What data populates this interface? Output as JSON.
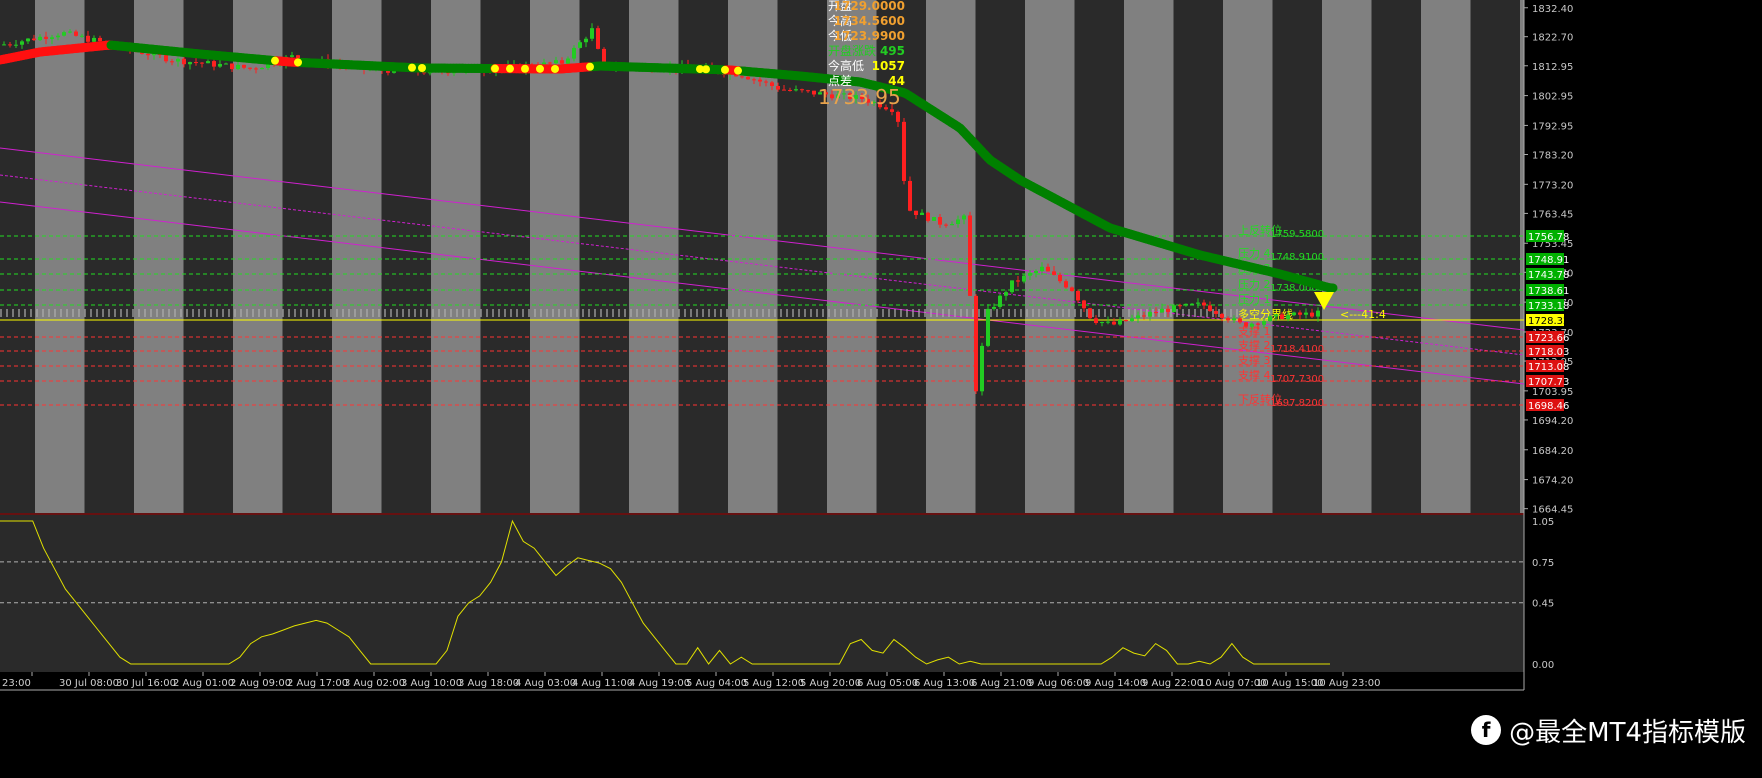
{
  "chart_data": {
    "type": "candlestick",
    "price_axis": {
      "ticks": [
        "1832.40",
        "1822.70",
        "1812.95",
        "1802.95",
        "1792.95",
        "1783.20",
        "1773.20",
        "1763.45",
        "1753.45",
        "1743.70",
        "1733.70",
        "1723.70",
        "1713.95",
        "1703.95",
        "1694.20",
        "1684.20",
        "1674.20",
        "1664.45"
      ]
    },
    "time_axis": {
      "ticks": [
        "23:00",
        "30 Jul 08:00",
        "30 Jul 16:00",
        "2 Aug 01:00",
        "2 Aug 09:00",
        "2 Aug 17:00",
        "3 Aug 02:00",
        "3 Aug 10:00",
        "3 Aug 18:00",
        "4 Aug 03:00",
        "4 Aug 11:00",
        "4 Aug 19:00",
        "5 Aug 04:00",
        "5 Aug 12:00",
        "5 Aug 20:00",
        "6 Aug 05:00",
        "6 Aug 13:00",
        "6 Aug 21:00",
        "9 Aug 06:00",
        "9 Aug 14:00",
        "9 Aug 22:00",
        "10 Aug 07:00",
        "10 Aug 15:00",
        "10 Aug 23:00"
      ]
    },
    "info_panel": [
      {
        "label": "开盘",
        "value": "1729.0000",
        "label_color": "#ffffff",
        "value_color": "#f0a030"
      },
      {
        "label": "今高",
        "value": "1734.5600",
        "label_color": "#ffffff",
        "value_color": "#f0a030"
      },
      {
        "label": "今低",
        "value": "1723.9900",
        "label_color": "#ffffff",
        "value_color": "#f0a030"
      },
      {
        "label": "开盘涨跌",
        "value": "495",
        "label_color": "#22cc22",
        "value_color": "#22cc22"
      },
      {
        "label": "今高低",
        "value": "1057",
        "label_color": "#ffffff",
        "value_color": "#ffff00"
      },
      {
        "label": "点差",
        "value": "44",
        "label_color": "#ffffff",
        "value_color": "#ffff00"
      }
    ],
    "current_price_label": "1733.95",
    "levels": [
      {
        "name": "上反转位",
        "value": "1759.5800",
        "axis_tag": "1756.78",
        "kind": "resistance"
      },
      {
        "name": "压力 4",
        "value": "1748.9100",
        "axis_tag": "1748.91",
        "kind": "resistance"
      },
      {
        "name": "压力 3",
        "value": "",
        "axis_tag": "1743.78",
        "kind": "resistance"
      },
      {
        "name": "压力 2",
        "value": "1738.0000",
        "axis_tag": "1738.61",
        "kind": "resistance"
      },
      {
        "name": "压力 1",
        "value": "",
        "axis_tag": "1733.18",
        "kind": "resistance"
      },
      {
        "name": "多空分界线",
        "value": "",
        "axis_tag": "1728.32",
        "kind": "pivot"
      },
      {
        "name": "支撑 1",
        "value": "",
        "axis_tag": "1723.66",
        "kind": "support"
      },
      {
        "name": "支撑 2",
        "value": "1718.4100",
        "axis_tag": "1718.03",
        "kind": "support"
      },
      {
        "name": "支撑 3",
        "value": "",
        "axis_tag": "1713.08",
        "kind": "support"
      },
      {
        "name": "支撑 4",
        "value": "1707.7300",
        "axis_tag": "1707.73",
        "kind": "support"
      },
      {
        "name": "下反转位",
        "value": "1697.8200",
        "axis_tag": "1698.46",
        "kind": "support"
      }
    ],
    "arrow_text": "<---41:4",
    "oscillator": {
      "ticks": [
        "1.05",
        "0.75",
        "0.45",
        "0.00"
      ],
      "values": [
        1.05,
        1.05,
        1.05,
        1.05,
        0.85,
        0.7,
        0.55,
        0.45,
        0.35,
        0.25,
        0.15,
        0.05,
        0.0,
        0.0,
        0.0,
        0.0,
        0.0,
        0.0,
        0.0,
        0.0,
        0.0,
        0.0,
        0.05,
        0.15,
        0.2,
        0.22,
        0.25,
        0.28,
        0.3,
        0.32,
        0.3,
        0.25,
        0.2,
        0.1,
        0.0,
        0.0,
        0.0,
        0.0,
        0.0,
        0.0,
        0.0,
        0.1,
        0.35,
        0.45,
        0.5,
        0.6,
        0.75,
        1.05,
        0.9,
        0.85,
        0.75,
        0.65,
        0.72,
        0.78,
        0.76,
        0.74,
        0.7,
        0.6,
        0.45,
        0.3,
        0.2,
        0.1,
        0.0,
        0.0,
        0.12,
        0.0,
        0.1,
        0.0,
        0.05,
        0.0,
        0.0,
        0.0,
        0.0,
        0.0,
        0.0,
        0.0,
        0.0,
        0.0,
        0.15,
        0.18,
        0.1,
        0.08,
        0.18,
        0.12,
        0.05,
        0.0,
        0.03,
        0.05,
        0.0,
        0.02,
        0.0,
        0.0,
        0.0,
        0.0,
        0.0,
        0.0,
        0.0,
        0.0,
        0.0,
        0.0,
        0.0,
        0.0,
        0.05,
        0.12,
        0.08,
        0.06,
        0.15,
        0.1,
        0.0,
        0.0,
        0.02,
        0.0,
        0.05,
        0.15,
        0.05,
        0.0,
        0.0,
        0.0,
        0.0,
        0.0,
        0.0,
        0.0,
        0.0
      ]
    },
    "colors": {
      "up_candle": "#22cc22",
      "down_candle": "#ff2020",
      "ma_up": "#008000",
      "ma_down": "#ff1010",
      "ma_cross": "#ffff00",
      "osc_line": "#e0e000",
      "resistance": "#22dd22",
      "support": "#ff3333",
      "pivot": "#ffff00",
      "magenta": "#d020d0"
    }
  },
  "watermark": {
    "text": "@最全MT4指标模版",
    "logo": "f"
  }
}
